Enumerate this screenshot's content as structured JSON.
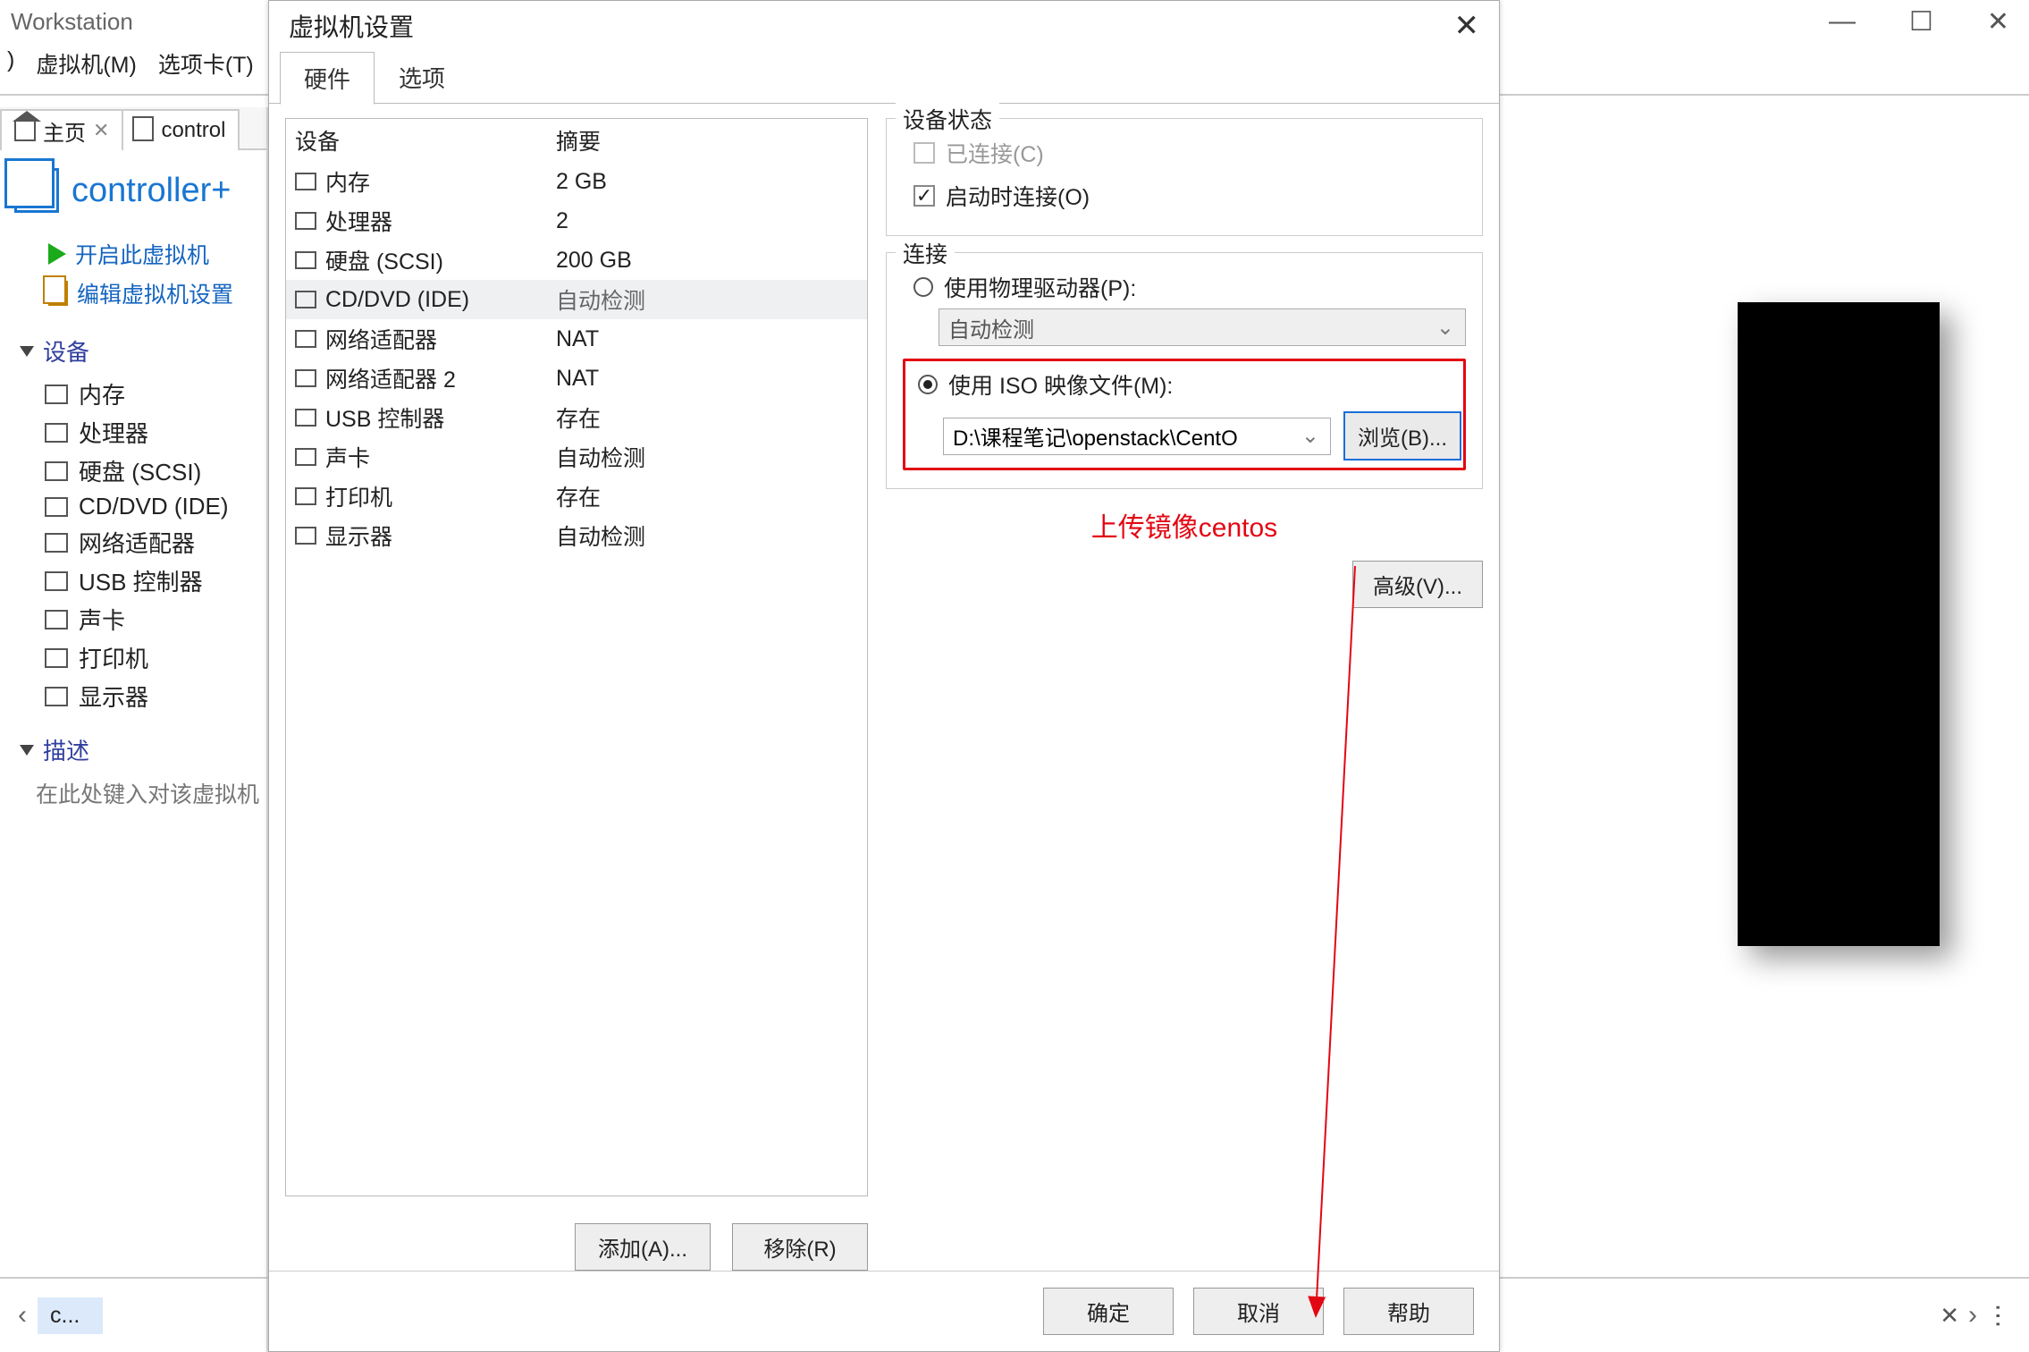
{
  "main": {
    "title": "Workstation",
    "menu": {
      "vm": "虚拟机(M)",
      "tabs": "选项卡(T)"
    },
    "tabs": {
      "home": "主页",
      "controller": "control"
    },
    "vm_title": "controller+",
    "actions": {
      "power_on": "开启此虚拟机",
      "edit": "编辑虚拟机设置"
    },
    "section_devices": "设备",
    "devices": [
      {
        "label": "内存"
      },
      {
        "label": "处理器"
      },
      {
        "label": "硬盘 (SCSI)"
      },
      {
        "label": "CD/DVD (IDE)"
      },
      {
        "label": "网络适配器"
      },
      {
        "label": "USB 控制器"
      },
      {
        "label": "声卡"
      },
      {
        "label": "打印机"
      },
      {
        "label": "显示器"
      }
    ],
    "section_desc": "描述",
    "desc_placeholder": "在此处键入对该虚拟机",
    "bottombar_item": "c..."
  },
  "dialog": {
    "title": "虚拟机设置",
    "tabs": {
      "hardware": "硬件",
      "options": "选项"
    },
    "table": {
      "headers": {
        "device": "设备",
        "summary": "摘要"
      },
      "rows": [
        {
          "device": "内存",
          "summary": "2 GB"
        },
        {
          "device": "处理器",
          "summary": "2"
        },
        {
          "device": "硬盘 (SCSI)",
          "summary": "200 GB"
        },
        {
          "device": "CD/DVD (IDE)",
          "summary": "自动检测",
          "selected": true
        },
        {
          "device": "网络适配器",
          "summary": "NAT"
        },
        {
          "device": "网络适配器 2",
          "summary": "NAT"
        },
        {
          "device": "USB 控制器",
          "summary": "存在"
        },
        {
          "device": "声卡",
          "summary": "自动检测"
        },
        {
          "device": "打印机",
          "summary": "存在"
        },
        {
          "device": "显示器",
          "summary": "自动检测"
        }
      ]
    },
    "buttons": {
      "add": "添加(A)...",
      "remove": "移除(R)"
    },
    "right": {
      "state_title": "设备状态",
      "connected": "已连接(C)",
      "connect_on": "启动时连接(O)",
      "conn_title": "连接",
      "use_physical": "使用物理驱动器(P):",
      "auto_detect": "自动检测",
      "use_iso": "使用 ISO 映像文件(M):",
      "iso_path": "D:\\课程笔记\\openstack\\CentO",
      "browse": "浏览(B)...",
      "annotation": "上传镜像centos",
      "advanced": "高级(V)..."
    },
    "footer": {
      "ok": "确定",
      "cancel": "取消",
      "help": "帮助"
    }
  }
}
